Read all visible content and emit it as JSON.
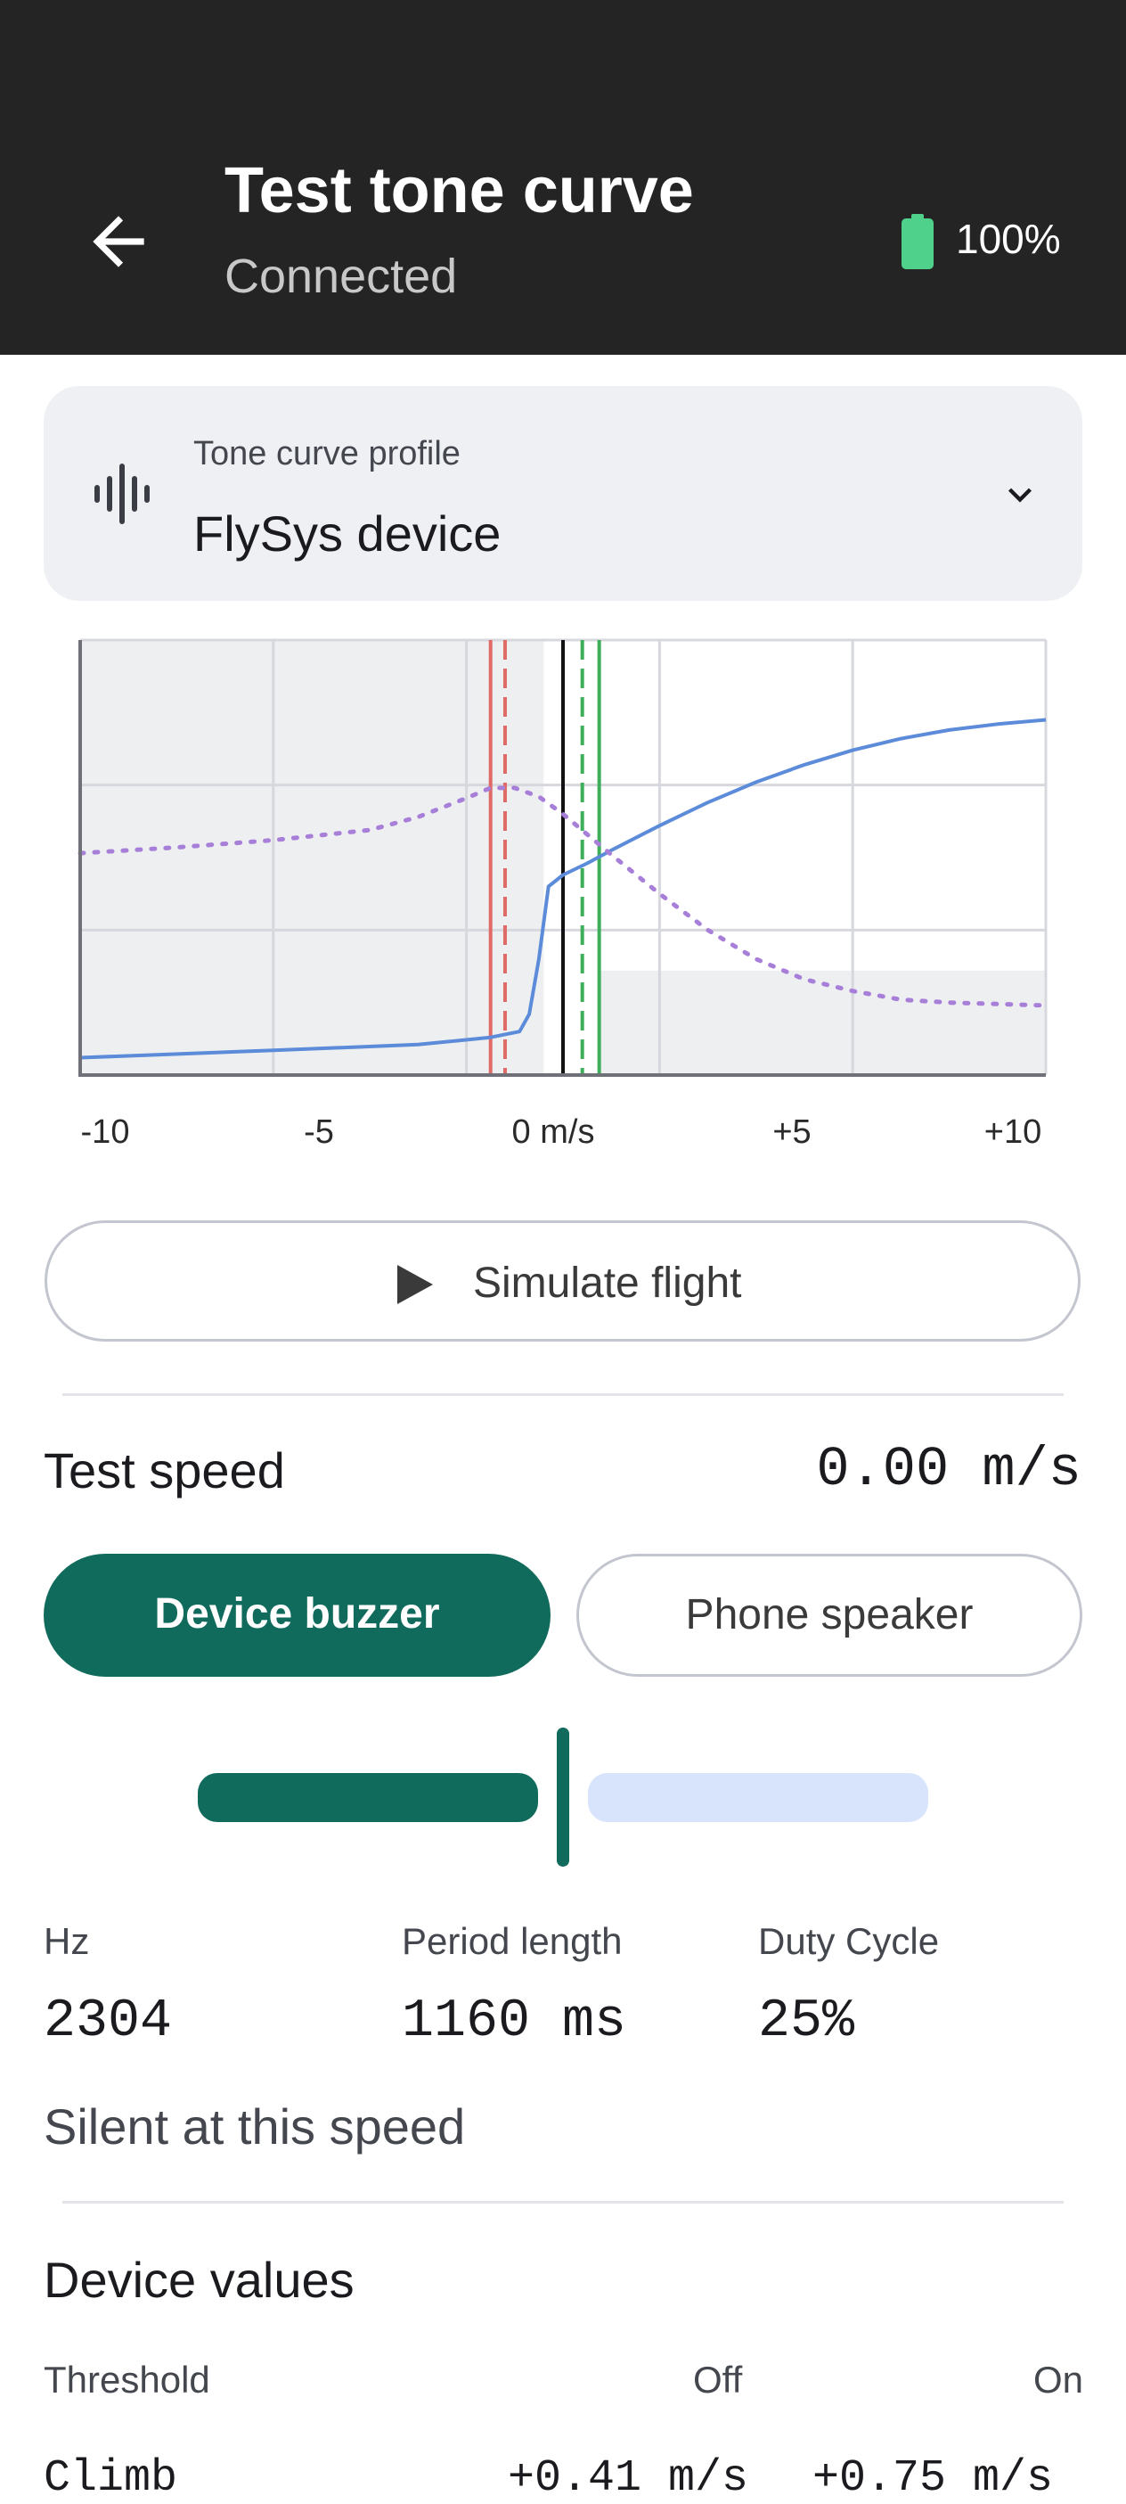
{
  "header": {
    "title": "Test tone curve",
    "status": "Connected",
    "battery_percent": "100%",
    "battery_color": "#4fd18b"
  },
  "profile": {
    "label": "Tone curve profile",
    "value": "FlySys device",
    "icon": "waveform-icon"
  },
  "chart_data": {
    "type": "line",
    "x_tick_labels": [
      "-10",
      "-5",
      "0 m/s",
      "+5",
      "+10"
    ],
    "xlim": [
      -10,
      10
    ],
    "ylim": [
      0,
      3
    ],
    "grid": true,
    "series": [
      {
        "color": "#5b8bd9",
        "style": "solid",
        "x": [
          -10,
          -6,
          -3,
          -1.5,
          -0.9,
          -0.7,
          -0.5,
          -0.3,
          0,
          0.5,
          1,
          2,
          3,
          4,
          5,
          6,
          7,
          8,
          9,
          10
        ],
        "y": [
          0.12,
          0.17,
          0.21,
          0.26,
          0.3,
          0.42,
          0.8,
          1.3,
          1.38,
          1.46,
          1.55,
          1.72,
          1.88,
          2.02,
          2.14,
          2.24,
          2.32,
          2.38,
          2.42,
          2.45
        ]
      },
      {
        "color": "#a87fd8",
        "style": "dotted",
        "x": [
          -10,
          -8,
          -6,
          -4,
          -3,
          -2,
          -1.5,
          -1,
          -0.5,
          0,
          0.5,
          1,
          2,
          3,
          4,
          5,
          6,
          7,
          8,
          9,
          10
        ],
        "y": [
          1.53,
          1.57,
          1.62,
          1.69,
          1.78,
          1.91,
          1.98,
          1.98,
          1.92,
          1.8,
          1.66,
          1.52,
          1.25,
          1.0,
          0.8,
          0.66,
          0.58,
          0.52,
          0.5,
          0.49,
          0.48
        ]
      }
    ],
    "markers": [
      {
        "x": -1.5,
        "color": "#e06a66",
        "style": "solid"
      },
      {
        "x": -1.2,
        "color": "#e06a66",
        "style": "dashed"
      },
      {
        "x": 0,
        "color": "#111111",
        "style": "solid"
      },
      {
        "x": 0.4,
        "color": "#3fae5a",
        "style": "dashed"
      },
      {
        "x": 0.75,
        "color": "#3fae5a",
        "style": "solid"
      }
    ],
    "shaded_regions": [
      {
        "x": [
          -10,
          -0.4
        ],
        "color": "#eeeff1"
      },
      {
        "x": [
          0.75,
          10
        ],
        "y_max": 0.72,
        "color": "#eeeff1"
      }
    ]
  },
  "simulate": {
    "label": "Simulate flight",
    "icon": "play-icon"
  },
  "test_speed": {
    "label": "Test speed",
    "value": "0.00 m/s",
    "level": 0.5
  },
  "output": {
    "device_label": "Device buzzer",
    "phone_label": "Phone speaker",
    "selected": "Device buzzer",
    "accent": "#116b5d"
  },
  "stats": [
    {
      "label": "Hz",
      "value": "2304"
    },
    {
      "label": "Period length",
      "value": "1160 ms"
    },
    {
      "label": "Duty Cycle",
      "value": "25%"
    }
  ],
  "silent_text": "Silent at this speed",
  "device_values": {
    "title": "Device values",
    "headers": {
      "threshold": "Threshold",
      "off": "Off",
      "on": "On"
    },
    "rows": [
      {
        "name": "Climb",
        "off": "+0.41 m/s",
        "on": "+0.75 m/s"
      }
    ]
  }
}
